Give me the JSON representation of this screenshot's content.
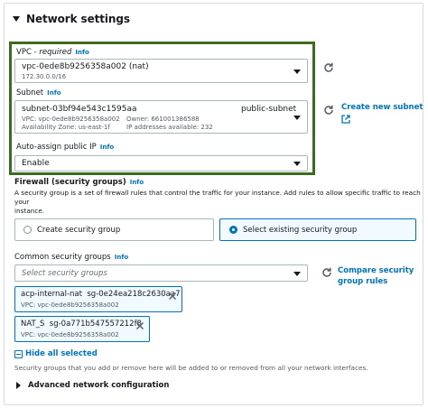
{
  "section": {
    "title": "Network settings"
  },
  "vpc": {
    "label": "VPC",
    "required": " - required",
    "info": "Info",
    "value": "vpc-0ede8b9256358a002 (nat)",
    "cidr": "172.30.0.0/16"
  },
  "subnet": {
    "label": "Subnet",
    "info": "Info",
    "id": "subnet-03bf94e543c1595aa",
    "name": "public-subnet",
    "vpc": "VPC: vpc-0ede8b9256358a002",
    "owner": "Owner: 661001386588",
    "az": "Availability Zone: us-east-1f",
    "ips": "IP addresses available: 232",
    "create_link": "Create new subnet"
  },
  "auto_assign": {
    "label": "Auto-assign public IP",
    "info": "Info",
    "value": "Enable"
  },
  "firewall": {
    "label": "Firewall (security groups)",
    "info": "Info",
    "description_line1": "A security group is a set of firewall rules that control the traffic for your instance. Add rules to allow specific traffic to reach your",
    "description_line2": "instance.",
    "option_create": "Create security group",
    "option_existing": "Select existing security group",
    "selected": "existing"
  },
  "common_sg": {
    "label": "Common security groups",
    "info": "Info",
    "placeholder": "Select security groups",
    "compare_link_line1": "Compare security",
    "compare_link_line2": "group rules",
    "tokens": [
      {
        "name": "acp-internal-nat",
        "sg": "sg-0e24ea218c2630aa7",
        "vpc": "VPC: vpc-0ede8b9256358a002"
      },
      {
        "name": "NAT_S",
        "sg": "sg-0a771b547557212f8",
        "vpc": "VPC: vpc-0ede8b9256358a002"
      }
    ],
    "hide_all": "Hide all selected",
    "note": "Security groups that you add or remove here will be added to or removed from all your network interfaces."
  },
  "advanced": {
    "label": "Advanced network configuration"
  },
  "colors": {
    "link": "#0073bb",
    "highlight": "#3d6b1f",
    "border": "#aab7b8"
  }
}
